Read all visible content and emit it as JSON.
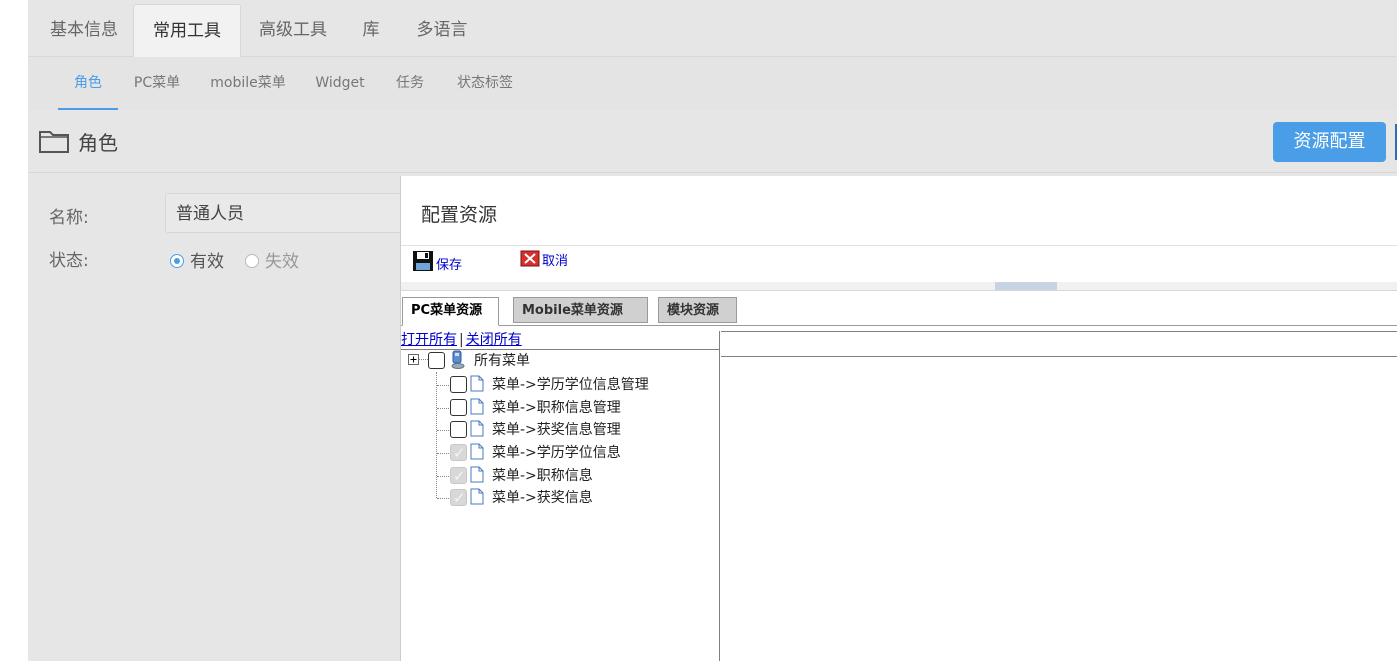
{
  "top_tabs": [
    "基本信息",
    "常用工具",
    "高级工具",
    "库",
    "多语言"
  ],
  "sub_tabs": [
    "角色",
    "PC菜单",
    "mobile菜单",
    "Widget",
    "任务",
    "状态标签"
  ],
  "header": {
    "title": "角色",
    "resource_button": "资源配置"
  },
  "form": {
    "name_label": "名称:",
    "name_value": "普通人员",
    "status_label": "状态:",
    "status_valid": "有效",
    "status_invalid": "失效"
  },
  "dialog": {
    "title": "配置资源",
    "save": "保存",
    "cancel": "取消",
    "tabs": [
      "PC菜单资源",
      "Mobile菜单资源",
      "模块资源"
    ],
    "open_all": "打开所有",
    "separator": "|",
    "close_all": "关闭所有",
    "tree": {
      "root": "所有菜单",
      "items": [
        {
          "label": "菜单->学历学位信息管理",
          "checked": false
        },
        {
          "label": "菜单->职称信息管理",
          "checked": false
        },
        {
          "label": "菜单->获奖信息管理",
          "checked": false
        },
        {
          "label": "菜单->学历学位信息",
          "checked": true
        },
        {
          "label": "菜单->职称信息",
          "checked": true
        },
        {
          "label": "菜单->获奖信息",
          "checked": true
        }
      ]
    }
  },
  "colors": {
    "accent": "#4a9ee8",
    "link": "#0000cc"
  }
}
